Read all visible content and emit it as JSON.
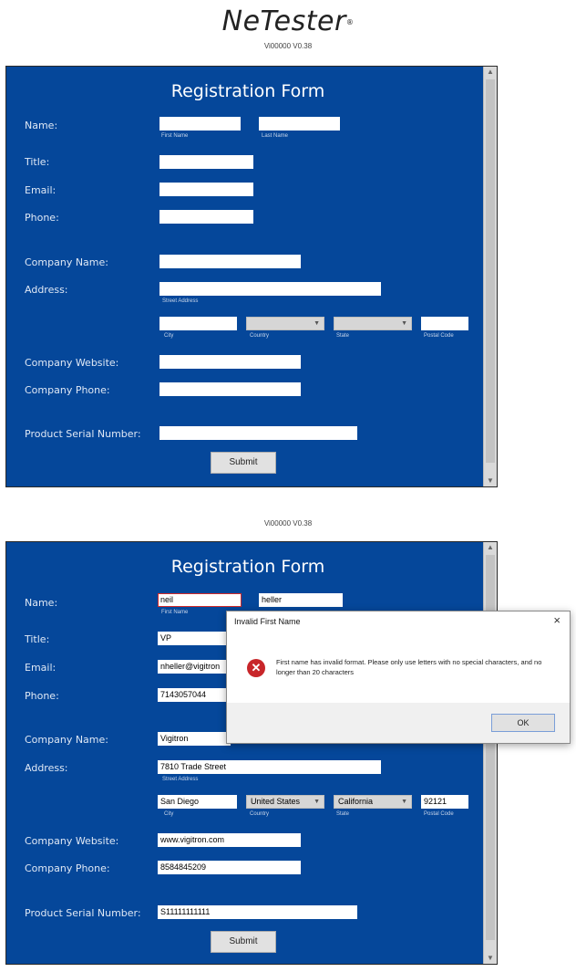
{
  "header": {
    "logo": "NeTester",
    "logo_mark": "®",
    "version_top": "Vi00000 V0.38",
    "version_mid": "Vi00000 V0.38"
  },
  "form_labels": {
    "title": "Registration Form",
    "name": "Name:",
    "title_field": "Title:",
    "email": "Email:",
    "phone": "Phone:",
    "company_name": "Company Name:",
    "address": "Address:",
    "company_website": "Company Website:",
    "company_phone": "Company Phone:",
    "serial": "Product Serial Number:",
    "first_name_sub": "First Name",
    "last_name_sub": "Last Name",
    "street_sub": "Street Address",
    "city_sub": "City",
    "country_sub": "Country",
    "state_sub": "State",
    "postal_sub": "Postal Code",
    "submit": "Submit"
  },
  "form1": {
    "first_name": "",
    "last_name": "",
    "title": "",
    "email": "",
    "phone": "",
    "company_name": "",
    "street": "",
    "city": "",
    "country": "",
    "state": "",
    "postal": "",
    "website": "",
    "company_phone": "",
    "serial": ""
  },
  "form2": {
    "first_name": "neil",
    "last_name": "heller",
    "title": "VP",
    "email": "nheller@vigitron",
    "phone": "7143057044",
    "company_name": "Vigitron",
    "street": "7810 Trade Street",
    "city": "San Diego",
    "country": "United States",
    "state": "California",
    "postal": "92121",
    "website": "www.vigitron.com",
    "company_phone": "8584845209",
    "serial": "S11111111111"
  },
  "dialog": {
    "title": "Invalid First Name",
    "close": "×",
    "icon": "error-icon",
    "message": "First name has invalid format. Please only use letters with no special characters, and no longer than 20 characters",
    "ok": "OK"
  },
  "colors": {
    "form_bg": "#05479a",
    "error_red": "#c8262a"
  }
}
